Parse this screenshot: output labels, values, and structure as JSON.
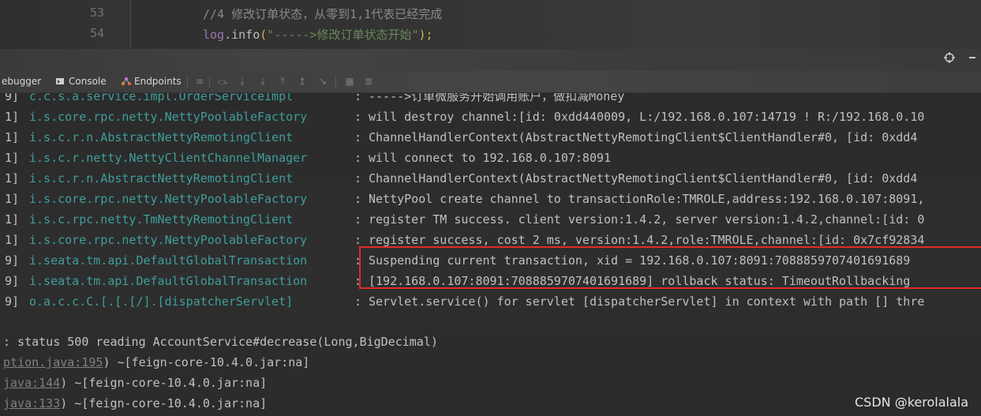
{
  "editor": {
    "lines": [
      {
        "number": "53",
        "comment": "//4 修改订单状态，从零到1,1代表已经完成"
      },
      {
        "number": "54",
        "object": "log",
        "dot": ".",
        "method": "info",
        "open": "(",
        "string": "\"----->修改订单状态开始\"",
        "close": ");"
      }
    ]
  },
  "toolwindow": {
    "tabs": [
      {
        "label": "ebugger",
        "icon": "debugger-icon"
      },
      {
        "label": "Console",
        "icon": "console-icon"
      },
      {
        "label": "Endpoints",
        "icon": "endpoints-icon"
      }
    ],
    "right_icons": [
      "crosshair-icon",
      "minimize-icon"
    ]
  },
  "console": {
    "log_rows": [
      {
        "prefix": "9]",
        "logger": "c.c.s.a.service.impl.OrderServiceImpl",
        "colon": ":",
        "message": "----->订单微服务开始调用账户，做扣减Money"
      },
      {
        "prefix": "1]",
        "logger": "i.s.core.rpc.netty.NettyPoolableFactory",
        "colon": ":",
        "message": "will destroy channel:[id: 0xdd440009, L:/192.168.0.107:14719 ! R:/192.168.0.10"
      },
      {
        "prefix": "1]",
        "logger": "i.s.c.r.n.AbstractNettyRemotingClient",
        "colon": ":",
        "message": "ChannelHandlerContext(AbstractNettyRemotingClient$ClientHandler#0, [id: 0xdd4"
      },
      {
        "prefix": "1]",
        "logger": "i.s.c.r.netty.NettyClientChannelManager",
        "colon": ":",
        "message": "will connect to 192.168.0.107:8091"
      },
      {
        "prefix": "1]",
        "logger": "i.s.c.r.n.AbstractNettyRemotingClient",
        "colon": ":",
        "message": "ChannelHandlerContext(AbstractNettyRemotingClient$ClientHandler#0, [id: 0xdd4"
      },
      {
        "prefix": "1]",
        "logger": "i.s.core.rpc.netty.NettyPoolableFactory",
        "colon": ":",
        "message": "NettyPool create channel to transactionRole:TMROLE,address:192.168.0.107:8091,"
      },
      {
        "prefix": "1]",
        "logger": "i.s.c.rpc.netty.TmNettyRemotingClient",
        "colon": ":",
        "message": "register TM success. client version:1.4.2, server version:1.4.2,channel:[id: 0"
      },
      {
        "prefix": "1]",
        "logger": "i.s.core.rpc.netty.NettyPoolableFactory",
        "colon": ":",
        "message": "register success, cost 2 ms, version:1.4.2,role:TMROLE,channel:[id: 0x7cf92834"
      },
      {
        "prefix": "9]",
        "logger": "i.seata.tm.api.DefaultGlobalTransaction",
        "colon": ":",
        "message": "Suspending current transaction, xid = 192.168.0.107:8091:7088859707401691689"
      },
      {
        "prefix": "9]",
        "logger": "i.seata.tm.api.DefaultGlobalTransaction",
        "colon": ":",
        "message": "[192.168.0.107:8091:7088859707401691689] rollback status: TimeoutRollbacking"
      },
      {
        "prefix": "9]",
        "logger": "o.a.c.c.C.[.[.[/].[dispatcherServlet]",
        "colon": ":",
        "message": "Servlet.service() for servlet [dispatcherServlet] in context with path [] thre"
      }
    ],
    "trace_rows": [
      {
        "link": "",
        "text": ": status 500 reading AccountService#decrease(Long,BigDecimal)"
      },
      {
        "link": "ption.java:195",
        "text": ") ~[feign-core-10.4.0.jar:na]"
      },
      {
        "link": "java:144",
        "text": ") ~[feign-core-10.4.0.jar:na]"
      },
      {
        "link": "java:133",
        "text": ") ~[feign-core-10.4.0.jar:na]"
      }
    ]
  },
  "watermark": "CSDN @kerolalala",
  "colors": {
    "logger": "#3f9e9a",
    "highlight_border": "#e02a2a",
    "string": "#6a8759"
  }
}
